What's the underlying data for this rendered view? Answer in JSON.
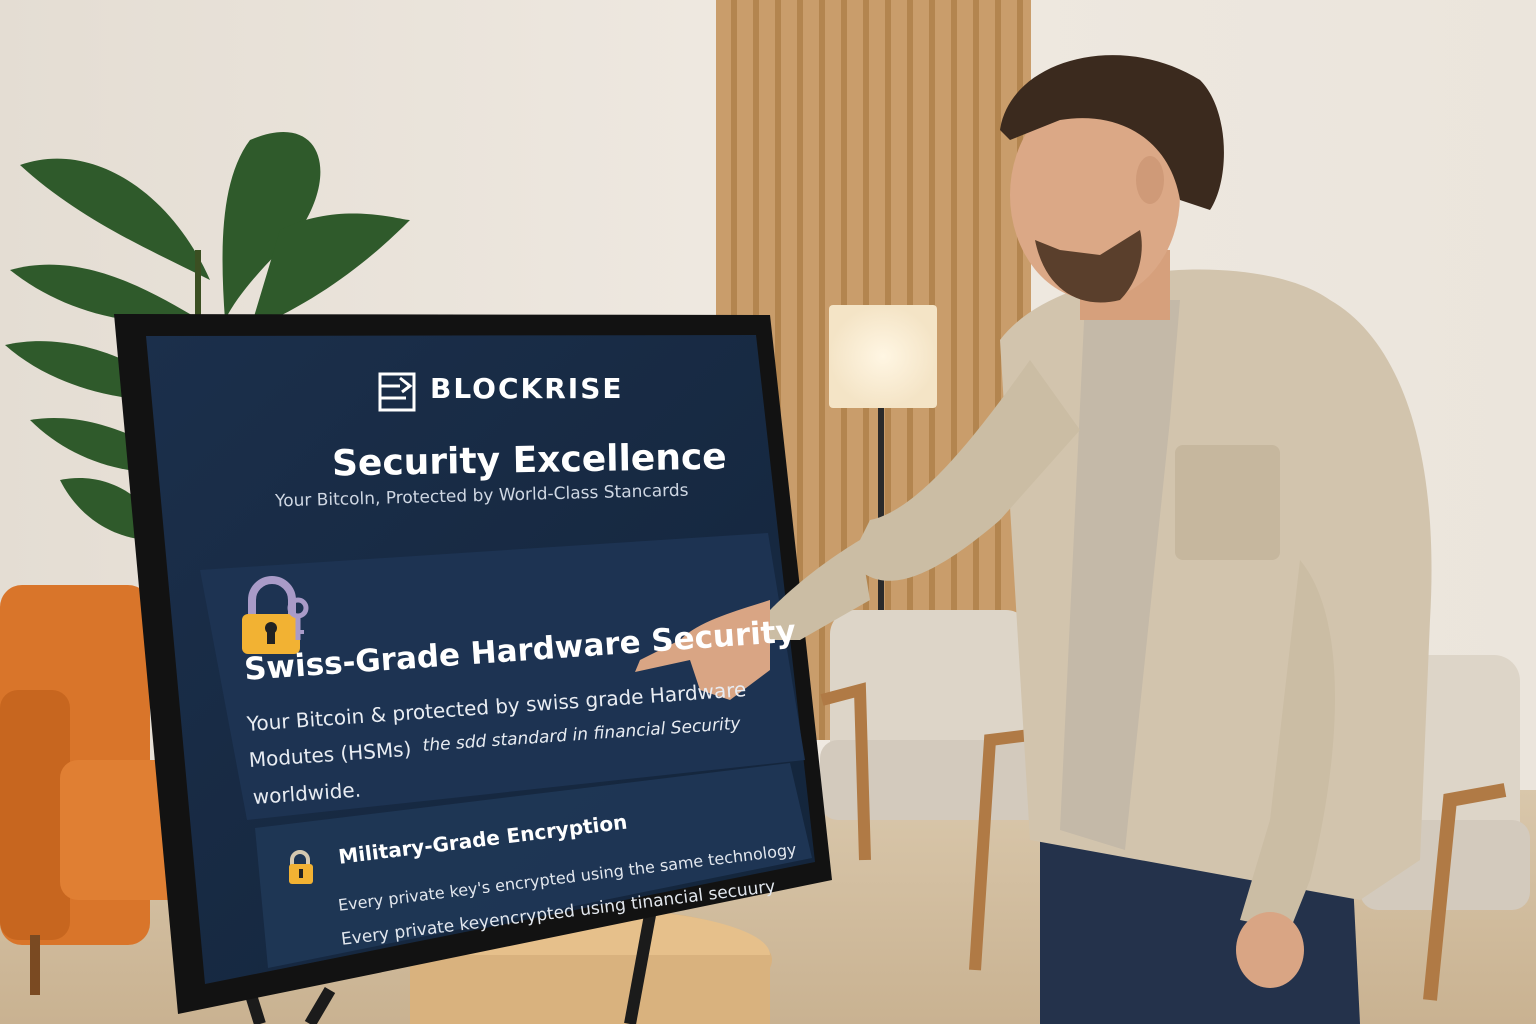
{
  "brand": {
    "name": "BLOCKRISE",
    "logo_icon": "blockrise-logo-icon"
  },
  "hero": {
    "title": "Security Excellence",
    "subtitle": "Your Bitcoln, Protected by World-Class Stancards"
  },
  "card_primary": {
    "icon": "padlock-key-icon",
    "title": "Swiss-Grade Hardware Security",
    "body_line1": "Your Bitcoin & protected by swiss grade Hardware",
    "body_line2a": "Modutes (HSMs)",
    "body_line2b": "the sdd standard in financial Security",
    "body_line3": "worldwide."
  },
  "card_secondary": {
    "icon": "padlock-icon",
    "title": "Military-Grade Encryption",
    "body_line1": "Every private key's encrypted using the same technology",
    "body_line2": "Every private keyencrypted using tinancial secuury"
  },
  "colors": {
    "screen_bg": "#172a43",
    "card_bg": "#1c3250",
    "accent_gold": "#f2b233",
    "lock_shackle": "#a99bc8",
    "wall": "#ece6dd",
    "shirt": "#d2c4ad",
    "sofa": "#d9752a"
  }
}
